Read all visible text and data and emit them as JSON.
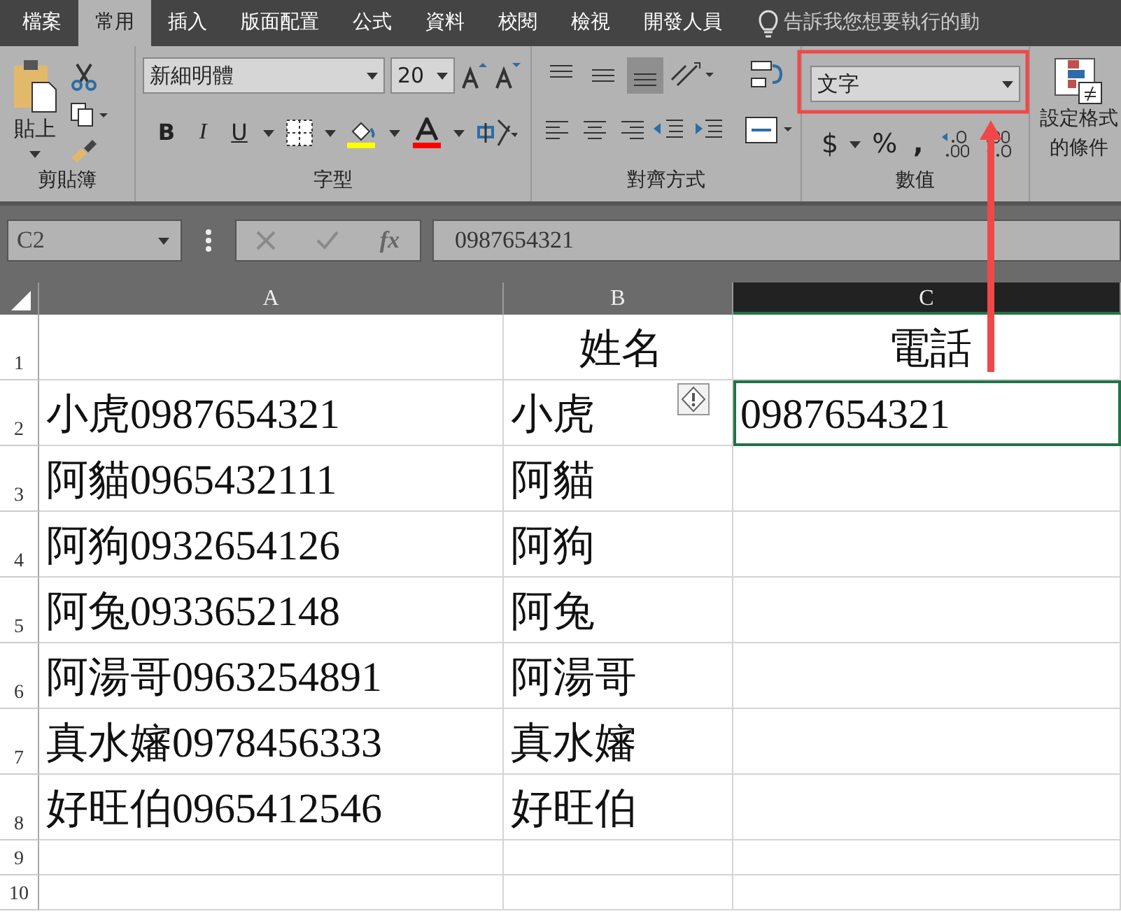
{
  "tabs": [
    {
      "label": "檔案",
      "selected": false
    },
    {
      "label": "常用",
      "selected": true
    },
    {
      "label": "插入",
      "selected": false
    },
    {
      "label": "版面配置",
      "selected": false
    },
    {
      "label": "公式",
      "selected": false
    },
    {
      "label": "資料",
      "selected": false
    },
    {
      "label": "校閱",
      "selected": false
    },
    {
      "label": "檢視",
      "selected": false
    },
    {
      "label": "開發人員",
      "selected": false
    }
  ],
  "tell_me": {
    "placeholder": "告訴我您想要執行的動"
  },
  "clipboard": {
    "paste_label": "貼上",
    "group_label": "剪貼簿"
  },
  "font": {
    "name": "新細明體",
    "size": "20",
    "bold": "B",
    "italic": "I",
    "underline": "U",
    "group_label": "字型"
  },
  "alignment": {
    "vertical": [
      {
        "selected": false
      },
      {
        "selected": false
      },
      {
        "selected": true
      }
    ],
    "group_label": "對齊方式"
  },
  "number": {
    "format": "文字",
    "highlighted": true,
    "currency": "$",
    "percent": "%",
    "comma": ",",
    "group_label": "數值"
  },
  "styles": {
    "line_1": "設定格式",
    "line_2": "的條件"
  },
  "name_box": "C2",
  "function_label": "fx",
  "formula": "0987654321",
  "columns": [
    {
      "label": "A",
      "selected": false
    },
    {
      "label": "B",
      "selected": false
    },
    {
      "label": "C",
      "selected": true
    }
  ],
  "rows": [
    {
      "header": "1",
      "b": "姓名",
      "c": "電話",
      "centered": true
    },
    {
      "header": "2",
      "a": "小虎0987654321",
      "b": "小虎",
      "c": "0987654321",
      "error_flag": true,
      "c_selected": true
    },
    {
      "header": "3",
      "a": "阿貓0965432111",
      "b": "阿貓"
    },
    {
      "header": "4",
      "a": "阿狗0932654126",
      "b": "阿狗"
    },
    {
      "header": "5",
      "a": "阿兔0933652148",
      "b": "阿兔"
    },
    {
      "header": "6",
      "a": "阿湯哥0963254891",
      "b": "阿湯哥"
    },
    {
      "header": "7",
      "a": "真水嬸0978456333",
      "b": "真水嬸"
    },
    {
      "header": "8",
      "a": "好旺伯0965412546",
      "b": "好旺伯"
    },
    {
      "header": "9",
      "short": true
    },
    {
      "header": "10",
      "short": true
    }
  ],
  "callout": {
    "shown": true
  }
}
